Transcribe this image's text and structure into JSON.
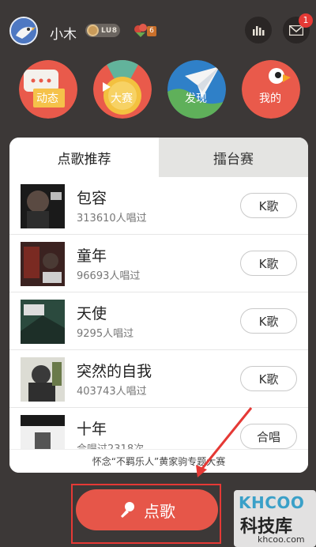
{
  "header": {
    "username": "小木",
    "level_badge": "LU8",
    "gift_count": "6",
    "notification_count": "1"
  },
  "nav": [
    {
      "label": "动态",
      "color": "#e95a4b"
    },
    {
      "label": "大赛",
      "color": "#e95a4b"
    },
    {
      "label": "发现",
      "color": "#2f80c8"
    },
    {
      "label": "我的",
      "color": "#e95a4b"
    }
  ],
  "tabs": {
    "active": "点歌推荐",
    "inactive": "擂台赛"
  },
  "songs": [
    {
      "title": "包容",
      "sub": "313610人唱过",
      "action": "K歌"
    },
    {
      "title": "童年",
      "sub": "96693人唱过",
      "action": "K歌"
    },
    {
      "title": "天使",
      "sub": "9295人唱过",
      "action": "K歌"
    },
    {
      "title": "突然的自我",
      "sub": "403743人唱过",
      "action": "K歌"
    },
    {
      "title": "十年",
      "sub": "合唱过2318次",
      "action": "合唱"
    }
  ],
  "footer_note": "怀念“不羁乐人”黄家驹专题大赛",
  "main_button": {
    "label": "点歌"
  },
  "watermark": {
    "logo": "KHCOO",
    "name": "科技库",
    "url": "khcoo.com"
  },
  "colors": {
    "background": "#3c3837",
    "accent": "#e65649",
    "highlight": "#e53935"
  }
}
